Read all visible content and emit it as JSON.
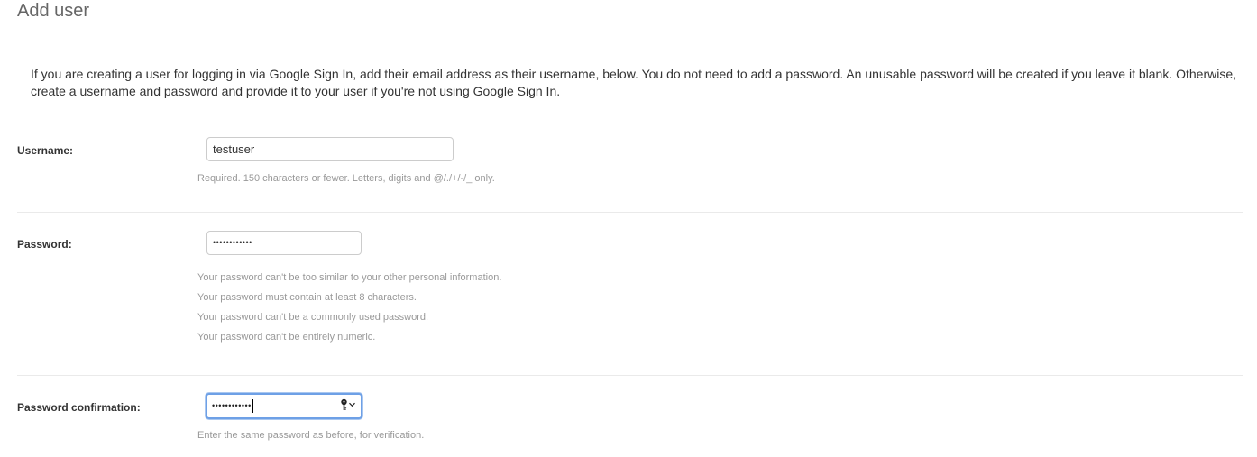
{
  "page": {
    "title": "Add user",
    "intro": "If you are creating a user for logging in via Google Sign In, add their email address as their username, below. You do not need to add a password. An unusable password will be created if you leave it blank. Otherwise, create a username and password and provide it to your user if you're not using Google Sign In."
  },
  "fields": {
    "username": {
      "label": "Username:",
      "value": "testuser",
      "help": "Required. 150 characters or fewer. Letters, digits and @/./+/-/_ only."
    },
    "password": {
      "label": "Password:",
      "value_masked": "••••••••••••",
      "help": [
        "Your password can't be too similar to your other personal information.",
        "Your password must contain at least 8 characters.",
        "Your password can't be a commonly used password.",
        "Your password can't be entirely numeric."
      ]
    },
    "password_confirmation": {
      "label": "Password confirmation:",
      "value_masked": "••••••••••••",
      "help": "Enter the same password as before, for verification.",
      "icon": "key-icon"
    }
  },
  "colors": {
    "focus_ring": "#6ea0e6",
    "help_text": "#999999",
    "title_text": "#666666"
  }
}
